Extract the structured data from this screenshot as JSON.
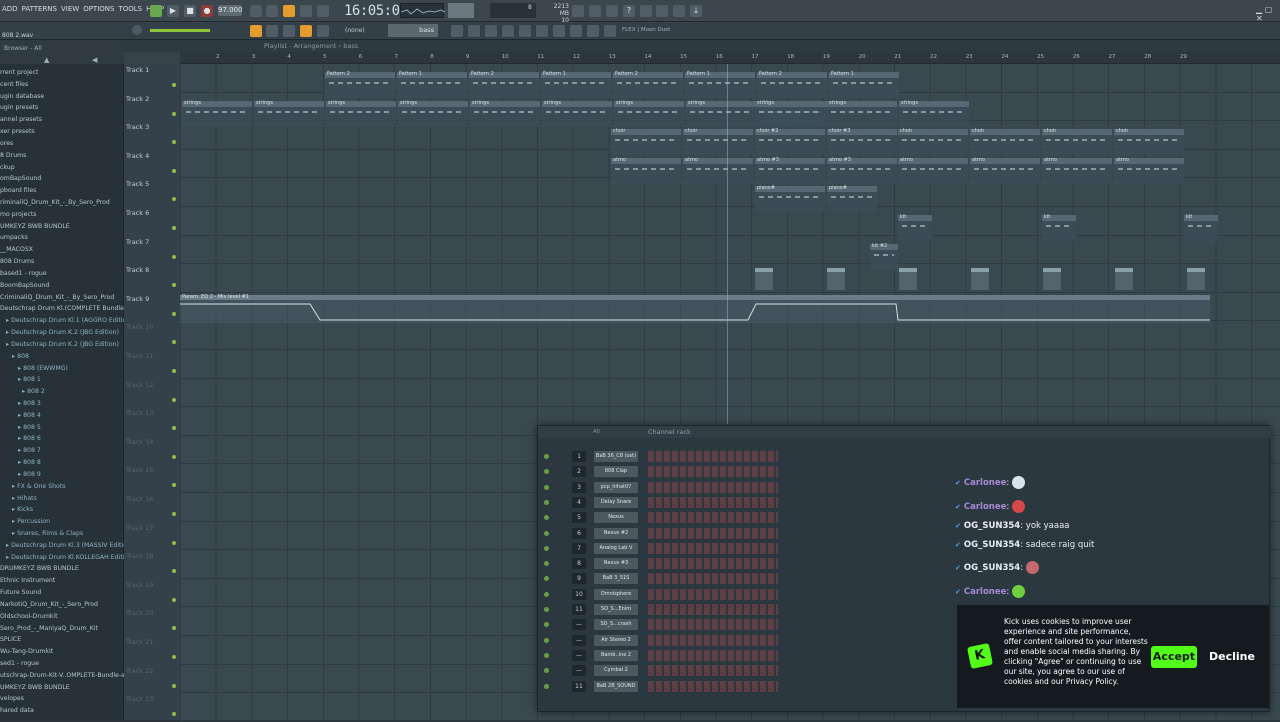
{
  "menu": [
    "ADD",
    "PATTERNS",
    "VIEW",
    "OPTIONS",
    "TOOLS",
    "HELP"
  ],
  "tempo": "97.000",
  "time": "16:05:00",
  "memory": [
    "8",
    "2213 MB",
    "10"
  ],
  "mode": "(none)",
  "snap": "bass",
  "playlist_title": "Playlist - Arrangement › bass",
  "flex_label": "FLEX | Moon Dust",
  "browser": {
    "file_label": "808 2.wav",
    "header": "Browser - All",
    "items": [
      {
        "text": "rrent project",
        "level": 0
      },
      {
        "text": "cent files",
        "level": 0
      },
      {
        "text": "ugin database",
        "level": 0
      },
      {
        "text": "ugin presets",
        "level": 0
      },
      {
        "text": "annel presets",
        "level": 0
      },
      {
        "text": "xer presets",
        "level": 0
      },
      {
        "text": "ores",
        "level": 0
      },
      {
        "text": "8 Drums",
        "level": 0
      },
      {
        "text": "ckup",
        "level": 0
      },
      {
        "text": "omBapSound",
        "level": 0
      },
      {
        "text": "pboard files",
        "level": 0
      },
      {
        "text": "riminaliQ_Drum_Kit_-_By_Sero_Prod",
        "level": 0
      },
      {
        "text": "mo projects",
        "level": 0
      },
      {
        "text": "UMKEYZ BWB BUNDLE",
        "level": 0
      },
      {
        "text": "umpacks",
        "level": 0
      },
      {
        "text": "__MACOSX",
        "level": 0
      },
      {
        "text": "808 Drums",
        "level": 0
      },
      {
        "text": "based1 - rogue",
        "level": 0
      },
      {
        "text": "BoomBapSound",
        "level": 0
      },
      {
        "text": "CriminaliQ_Drum_Kit_-_By_Sero_Prod",
        "level": 0
      },
      {
        "text": "Deutschrap Drum Kl.(COMPLETE Bundle)",
        "level": 0
      },
      {
        "text": "Deutschrap Drum Kl.1 (AGGRO Edition)",
        "level": 1
      },
      {
        "text": "Deutschrap Drum K.2 (JBG Edition)",
        "level": 1
      },
      {
        "text": "Deutschrap Drum K.2 (JBG Edition)",
        "level": 1
      },
      {
        "text": "808",
        "level": 2
      },
      {
        "text": "808 (EWWMG)",
        "level": 3
      },
      {
        "text": "808 1",
        "level": 3
      },
      {
        "text": "808 2",
        "level": 4,
        "selected": true
      },
      {
        "text": "808 3",
        "level": 3
      },
      {
        "text": "808 4",
        "level": 3
      },
      {
        "text": "808 5",
        "level": 3
      },
      {
        "text": "808 6",
        "level": 3
      },
      {
        "text": "808 7",
        "level": 3
      },
      {
        "text": "808 8",
        "level": 3
      },
      {
        "text": "808 9",
        "level": 3
      },
      {
        "text": "FX & One Shots",
        "level": 2
      },
      {
        "text": "Hihats",
        "level": 2
      },
      {
        "text": "Kicks",
        "level": 2
      },
      {
        "text": "Percussion",
        "level": 2
      },
      {
        "text": "Snares, Rims & Claps",
        "level": 2
      },
      {
        "text": "Deutschrap Drum Kl.3 (MASSIV Edition)",
        "level": 1
      },
      {
        "text": "Deutschrap Drum Kl.KOLLEGAH Edition)",
        "level": 1
      },
      {
        "text": "DRUMKEYZ BWB BUNDLE",
        "level": 0
      },
      {
        "text": "Ethnic Instrument",
        "level": 0
      },
      {
        "text": "Future Sound",
        "level": 0
      },
      {
        "text": "NarkotiQ_Drum_Kit_-_Sero_Prod",
        "level": 0
      },
      {
        "text": "Oldschool-Drumkit",
        "level": 0
      },
      {
        "text": "Sero_Prod_-_ManiyaQ_Drum_Kit",
        "level": 0
      },
      {
        "text": "SPLICE",
        "level": 0
      },
      {
        "text": "Wu-Tang-Drumkit",
        "level": 0
      },
      {
        "text": "sed1 - rogue",
        "level": 0
      },
      {
        "text": "utschrap-Drum-Kit-V..OMPLETE-Bundle-aa7pck",
        "level": 0
      },
      {
        "text": "UMKEYZ BWB BUNDLE",
        "level": 0
      },
      {
        "text": "velopes",
        "level": 0
      },
      {
        "text": "hared data",
        "level": 0
      }
    ]
  },
  "tracks": [
    "Track 1",
    "Track 2",
    "Track 3",
    "Track 4",
    "Track 5",
    "Track 6",
    "Track 7",
    "Track 8",
    "Track 9",
    "Track 10",
    "Track 11",
    "Track 12",
    "Track 13",
    "Track 14",
    "Track 15",
    "Track 16",
    "Track 17",
    "Track 18",
    "Track 19",
    "Track 20",
    "Track 21",
    "Track 22",
    "Track 23"
  ],
  "ruler": [
    "2",
    "3",
    "4",
    "5",
    "6",
    "7",
    "8",
    "9",
    "10",
    "11",
    "12",
    "13",
    "14",
    "15",
    "16",
    "17",
    "18",
    "19",
    "20",
    "21",
    "22",
    "23",
    "24",
    "25",
    "26",
    "27",
    "28",
    "29"
  ],
  "clip_labels": {
    "pattern": "Pattern 2",
    "pattern1": "Pattern 1",
    "strings": "strings",
    "choir": "choir",
    "choir2": "choir #2",
    "choir3": "choir #3",
    "atmo": "atmo",
    "atmo3": "atmo #3",
    "piano": "piano#",
    "kit": "kit",
    "kit2": "kit #2",
    "automation": "Param. EQ 2 - Mix level #1"
  },
  "rack": {
    "title": "Channel rack",
    "filter": "All",
    "channels": [
      {
        "num": "1",
        "name": "BaB 36_C8 (ost)"
      },
      {
        "num": "2",
        "name": "808 Clap"
      },
      {
        "num": "3",
        "name": "pcp_hihat07"
      },
      {
        "num": "4",
        "name": "Delay Snare"
      },
      {
        "num": "5",
        "name": "Nexus"
      },
      {
        "num": "6",
        "name": "Nexus #2"
      },
      {
        "num": "7",
        "name": "Analog Lab V"
      },
      {
        "num": "8",
        "name": "Nexus #3"
      },
      {
        "num": "9",
        "name": "BaB 3_51S"
      },
      {
        "num": "10",
        "name": "Omnisphere"
      },
      {
        "num": "11",
        "name": "SO_S...Enim"
      },
      {
        "num": "—",
        "name": "SD_S...crash"
      },
      {
        "num": "—",
        "name": "Air Stereo 2"
      },
      {
        "num": "—",
        "name": "Bamb..ine 2"
      },
      {
        "num": "—",
        "name": "Cymbal 2"
      },
      {
        "num": "11",
        "name": "BaB 2B_SOUND"
      }
    ]
  },
  "chat": [
    {
      "user": "Carlonee",
      "text": "",
      "emote_color": "#d9e4ea",
      "purple": true
    },
    {
      "user": "Carlonee",
      "text": "",
      "emote_color": "#d84848",
      "purple": true
    },
    {
      "user": "OG_SUN354",
      "text": ": yok yaaaa",
      "emote_color": "",
      "purple": false
    },
    {
      "user": "OG_SUN354",
      "text": ": sadece raig quit",
      "emote_color": "",
      "purple": false
    },
    {
      "user": "OG_SUN354",
      "text": ":",
      "emote_color": "#c46a6a",
      "purple": false
    },
    {
      "user": "Carlonee",
      "text": "",
      "emote_color": "#6fcf3c",
      "purple": true
    }
  ],
  "cookie": {
    "text": "Kick uses cookies to improve user experience and site performance, offer content tailored to your interests and enable social media sharing. By clicking \"Agree\" or continuing to use our site, you agree to our use of cookies and our Privacy Policy.",
    "accept": "Accept",
    "decline": "Decline",
    "logo": "K"
  },
  "colors": {
    "accent": "#e59b2e",
    "kick_green": "#53fc18"
  }
}
